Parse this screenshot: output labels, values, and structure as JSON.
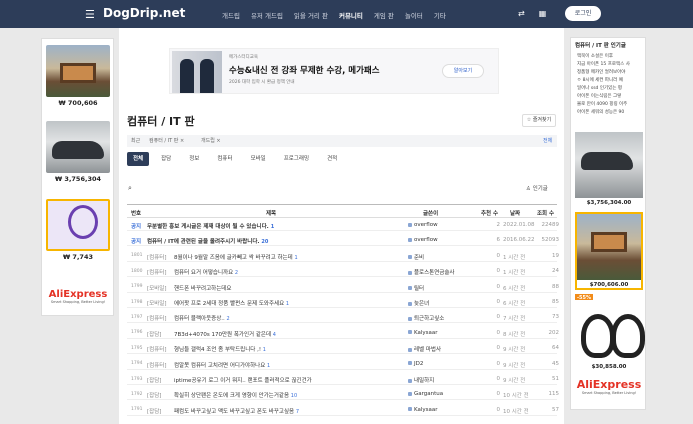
{
  "header": {
    "logo": "DogDrip.net",
    "nav": [
      "개드립",
      "유저 개드립",
      "읽을 거리 판",
      "커뮤니티",
      "게임 판",
      "놀이터",
      "기타"
    ],
    "active_nav": 3,
    "login": "로그인"
  },
  "left_ads": [
    {
      "price": "₩ 700,606",
      "image": "house"
    },
    {
      "price": "₩ 3,756,304",
      "image": "car"
    },
    {
      "price": "₩ 7,743",
      "image": "racket"
    }
  ],
  "aliexpress": {
    "logo": "AliExpress",
    "tagline": "Smart Shopping, Better Living!"
  },
  "banner": {
    "label": "메가스터디교육",
    "title": "수능&내신 전 강좌 무제한 수강, 메가패스",
    "sub": "2026 대학 입학 시 환급 정책 안내",
    "button": "알아보기"
  },
  "board": {
    "title": "컴퓨터 / IT 판",
    "favorite": "즐겨찾기",
    "recent_label": "최근",
    "recent_items": [
      "컴퓨터 / IT 판",
      "개드립"
    ],
    "recent_delete": "전체",
    "tabs": [
      "전체",
      "잡담",
      "정보",
      "컴퓨터",
      "모바일",
      "프로그래밍",
      "견적"
    ],
    "active_tab": 0,
    "popular": "인기글",
    "columns": {
      "no": "번호",
      "title": "제목",
      "author": "글쓴이",
      "rec": "추천 수",
      "date": "날짜",
      "views": "조회 수"
    },
    "rows": [
      {
        "no": "공지",
        "cat": "",
        "title": "무분별한 홍보 게시글은 제재 대상이 될 수 있습니다.",
        "cmt": "1",
        "author": "overflow",
        "rec": "2",
        "date": "2022.01.08",
        "views": "22489",
        "notice": true
      },
      {
        "no": "공지",
        "cat": "",
        "title": "컴퓨터 / IT에 관련된 글을 올려주시기 바랍니다.",
        "cmt": "20",
        "author": "overflow",
        "rec": "6",
        "date": "2016.06.22",
        "views": "52093",
        "notice": true
      },
      {
        "no": "1801",
        "cat": "[컴퓨터]",
        "title": "8월이나 9월말 즈음에 글카빼고 싹 바꾸려고 하는데",
        "cmt": "1",
        "author": "준비",
        "rec": "0",
        "date": "1 시간 전",
        "views": "19"
      },
      {
        "no": "1800",
        "cat": "[컴퓨터]",
        "title": "컴퓨터 요거 어떻습니까요",
        "cmt": "2",
        "author": "플로스톤연금술사",
        "rec": "0",
        "date": "1 시간 전",
        "views": "24"
      },
      {
        "no": "1799",
        "cat": "[모바일]",
        "title": "핸드폰 바꾸려고하는데요",
        "cmt": "",
        "author": "릴터",
        "rec": "0",
        "date": "6 시간 전",
        "views": "88"
      },
      {
        "no": "1798",
        "cat": "[모바일]",
        "title": "에어팟 프로 2세대 정품 빨펀스 문제 도와주세요",
        "cmt": "1",
        "author": "늦은녀",
        "rec": "0",
        "date": "6 시간 전",
        "views": "85"
      },
      {
        "no": "1797",
        "cat": "[컴퓨터]",
        "title": "컴퓨터 블랙아웃증상..",
        "cmt": "2",
        "author": "퇴근하고싶소",
        "rec": "0",
        "date": "7 시간 전",
        "views": "73"
      },
      {
        "no": "1796",
        "cat": "[잡담]",
        "title": "7B3d+4070s 170만원 폭가인거 같은데",
        "cmt": "4",
        "author": "Kalysaar",
        "rec": "0",
        "date": "8 시간 전",
        "views": "202"
      },
      {
        "no": "1795",
        "cat": "[컴퓨터]",
        "title": "형님들 갤럭4 조언 좀 부탁드립니다 ,!",
        "cmt": "1",
        "author": "레벨 마법사",
        "rec": "0",
        "date": "9 시간 전",
        "views": "64"
      },
      {
        "no": "1794",
        "cat": "[컴퓨터]",
        "title": "컴알못 컴퓨터 고치려면 어디가야하나요",
        "cmt": "1",
        "author": "JD2",
        "rec": "0",
        "date": "9 시간 전",
        "views": "45"
      },
      {
        "no": "1793",
        "cat": "[잡담]",
        "title": "iptime공유기 로그 이거 뭐지.. 랜포트 플러적으로 끊긴건가",
        "cmt": "",
        "author": "내밀하지",
        "rec": "0",
        "date": "9 시간 전",
        "views": "51"
      },
      {
        "no": "1792",
        "cat": "[잡담]",
        "title": "확실히 상단팬은 온도에 크게 영향이 안가는거같음",
        "cmt": "10",
        "author": "Gargantua",
        "rec": "0",
        "date": "10 시간 전",
        "views": "115"
      },
      {
        "no": "1791",
        "cat": "[잡담]",
        "title": "패컴도 바꾸고싶고 맥도 바꾸고싶고 폰도 바꾸고싶음",
        "cmt": "7",
        "author": "Kalysaar",
        "rec": "0",
        "date": "10 시간 전",
        "views": "57"
      }
    ]
  },
  "right_sidebar": {
    "title": "컴퓨터 / IT 판 인기글",
    "popular": [
      "맥북이 소설은 이후",
      "지금 아이폰 15 프로맥스 사",
      "정품형 메카인 얼려보아야",
      "ㅇ 8시에 세컨 파니러 예",
      "일어나 ssd 인기있는 평",
      "아이폰 이는식림은 그렇",
      "몰로 만이 4090 핑링 이주",
      "아이폰 세워의 성능은 90"
    ],
    "products": [
      {
        "price": "$3,756,304.00",
        "image": "car"
      },
      {
        "price": "$700,606.00",
        "image": "house"
      },
      {
        "price": "$30,858.00",
        "image": "earbuds",
        "badge": "-55%"
      }
    ]
  },
  "colors": {
    "header": "#2d3d59",
    "link": "#3a6fd8",
    "ali": "#e43225"
  }
}
